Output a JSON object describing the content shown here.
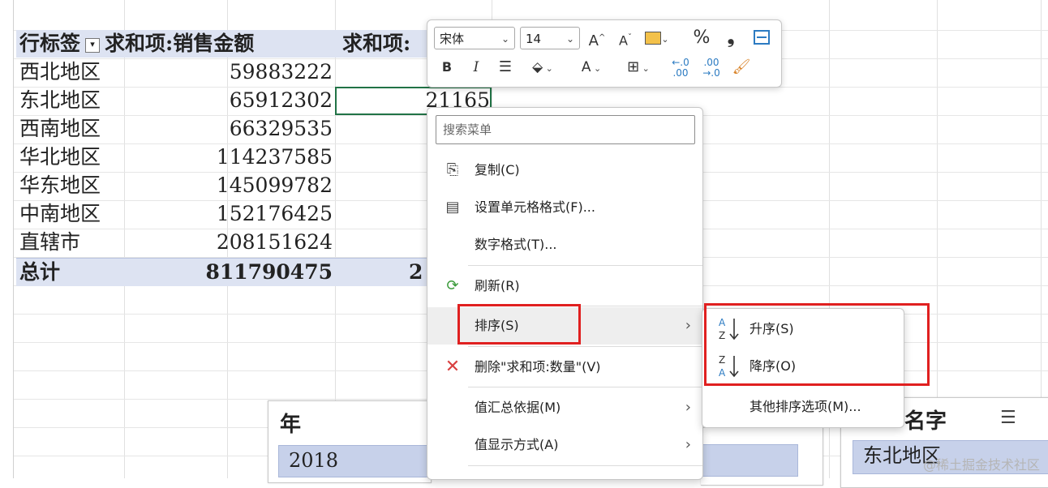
{
  "pivot": {
    "header": {
      "row_label": "行标签",
      "col1": "求和项:销售金额",
      "col2": "求和项:"
    },
    "rows": [
      {
        "label": "西北地区",
        "value": "59883222"
      },
      {
        "label": "东北地区",
        "value": "65912302",
        "extra": "21165"
      },
      {
        "label": "西南地区",
        "value": "66329535"
      },
      {
        "label": "华北地区",
        "value": "114237585"
      },
      {
        "label": "华东地区",
        "value": "145099782"
      },
      {
        "label": "中南地区",
        "value": "152176425"
      },
      {
        "label": "直辖市",
        "value": "208151624"
      }
    ],
    "total": {
      "label": "总计",
      "value": "811790475",
      "extra": "2"
    }
  },
  "slicers": {
    "year": {
      "title": "年",
      "item": "2018"
    },
    "name": {
      "title": "名字",
      "item": "东北地区"
    }
  },
  "minibar": {
    "font_name": "宋体",
    "font_size": "14",
    "grow_font": "A",
    "shrink_font": "A",
    "percent": "%",
    "comma": "❟",
    "bold": "B",
    "italic": "I",
    "font_color": "A"
  },
  "context_menu": {
    "search_placeholder": "搜索菜单",
    "items": {
      "copy": "复制(C)",
      "format_cells": "设置单元格格式(F)...",
      "number_format": "数字格式(T)...",
      "refresh": "刷新(R)",
      "sort": "排序(S)",
      "delete": "删除\"求和项:数量\"(V)",
      "summarize_by": "值汇总依据(M)",
      "show_as": "值显示方式(A)"
    }
  },
  "sort_submenu": {
    "ascending": "升序(S)",
    "descending": "降序(O)",
    "more": "其他排序选项(M)..."
  },
  "watermark": "@稀土掘金技术社区",
  "colors": {
    "highlight_red": "#e02020",
    "pivot_header": "#dde3f2",
    "selection_green": "#217346"
  }
}
